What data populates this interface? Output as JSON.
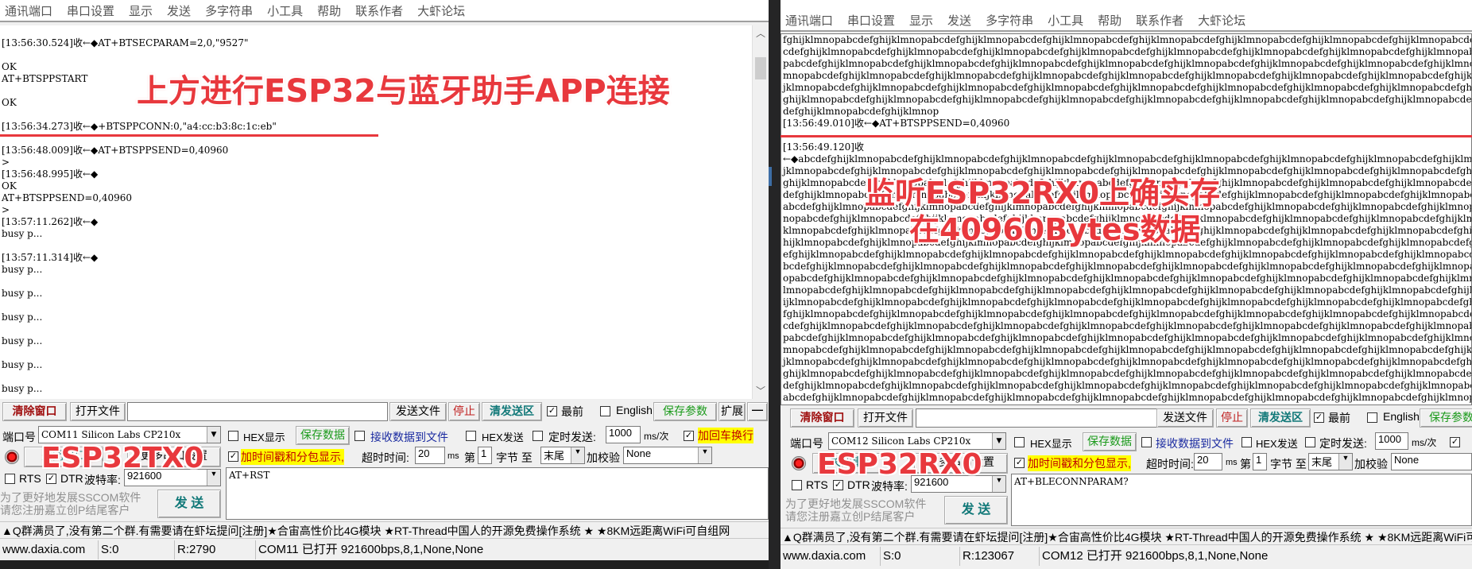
{
  "menu": [
    "通讯端口",
    "串口设置",
    "显示",
    "发送",
    "多字符串",
    "小工具",
    "帮助",
    "联系作者",
    "大虾论坛"
  ],
  "left": {
    "receive_lines": [
      "",
      "[13:56:30.524]收←◆AT+BTSECPARAM=2,0,\"9527\"",
      "",
      "OK",
      "AT+BTSPPSTART",
      "",
      "OK",
      "",
      "[13:56:34.273]收←◆+BTSPPCONN:0,\"a4:cc:b3:8c:1c:eb\"",
      "",
      "[13:56:48.009]收←◆AT+BTSPPSEND=0,40960",
      ">",
      "[13:56:48.995]收←◆",
      "OK",
      "AT+BTSPPSEND=0,40960",
      ">",
      "[13:57:11.262]收←◆",
      "busy p...",
      "",
      "[13:57:11.314]收←◆",
      "busy p...",
      "",
      "busy p...",
      "",
      "busy p...",
      "",
      "busy p...",
      "",
      "busy p...",
      "",
      "busy p..."
    ],
    "annotation_top": "上方进行ESP32与蓝牙助手APP连接",
    "annotation_device": "ESP32TX0",
    "port_value": "COM11 Silicon Labs CP210x",
    "open_button": "关闭串口",
    "more_settings_button": "更多串口设置",
    "send_text": "AT+RST",
    "status": {
      "site": "www.daxia.com",
      "sent": "S:0",
      "received": "R:2790",
      "port_state": "COM11 已打开  921600bps,8,1,None,None"
    }
  },
  "right": {
    "receive_lines": [
      "fghijklmnopabcdefghijklmnopabcdefghijklmnopabcdefghijklmnopabcdefghijklmnopabcdefghijklmnopabcdefghijklmnopabcdefghijklmnopabcdefghi",
      "cdefghijklmnopabcdefghijklmnopabcdefghijklmnopabcdefghijklmnopabcdefghijklmnopabcdefghijklmnopabcdefghijklmnopabcdefghijklmnopabcdef",
      "pabcdefghijklmnopabcdefghijklmnopabcdefghijklmnopabcdefghijklmnopabcdefghijklmnopabcdefghijklmnopabcdefghijklmnopabcdefghijklmnopabc",
      "mnopabcdefghijklmnopabcdefghijklmnopabcdefghijklmnopabcdefghijklmnopabcdefghijklmnopabcdefghijklmnopabcdefghijklmnopabcdefghijklmnop",
      "jklmnopabcdefghijklmnopabcdefghijklmnopabcdefghijklmnopabcdefghijklmnopabcdefghijklmnopabcdefghijklmnopabcdefghijklmnopabcdefghijklm",
      "ghijklmnopabcdefghijklmnopabcdefghijklmnopabcdefghijklmnopabcdefghijklmnopabcdefghijklmnopabcdefghijklmnopabcdefghijklmnopabcdefghij",
      "defghijklmnopabcdefghijklmnop",
      "[13:56:49.010]收←◆AT+BTSPPSEND=0,40960",
      "",
      "[13:56:49.120]收",
      "←◆abcdefghijklmnopabcdefghijklmnopabcdefghijklmnopabcdefghijklmnopabcdefghijklmnopabcdefghijklmnopabcdefghijklmnopabcdefghijklmnop",
      "jklmnopabcdefghijklmnopabcdefghijklmnopabcdefghijklmnopabcdefghijklmnopabcdefghijklmnopabcdefghijklmnopabcdefghijklmnopabcdefghijklm",
      "ghijklmnopabcdefghijklmnopabcdefghijklmnopabcdefghijklmnopabcdefghijklmnopabcdefghijklmnopabcdefghijklmnopabcdefghijklmnopabcdefghij",
      "defghijklmnopabcdefghijklmnopabcdefghijklmnopabcdefghijklmnopabcdefghijklmnopabcdefghijklmnopabcdefghijklmnopabcdefghijklmnopabcdefg",
      "abcdefghijklmnopabcdefghijklmnopabcdefghijklmnopabcdefghijklmnopabcdefghijklmnopabcdefghijklmnopabcdefghijklmnopabcdefghijklmnopabcd",
      "nopabcdefghijklmnopabcdefghijklmnopabcdefghijklmnopabcdefghijklmnopabcdefghijklmnopabcdefghijklmnopabcdefghijklmnopabcdefghijklmnopa",
      "klmnopabcdefghijklmnopabcdefghijklmnopabcdefghijklmnopabcdefghijklmnopabcdefghijklmnopabcdefghijklmnopabcdefghijklmnopabcdefghijklmn",
      "hijklmnopabcdefghijklmnopabcdefghijklmnopabcdefghijklmnopabcdefghijklmnopabcdefghijklmnopabcdefghijklmnopabcdefghijklmnopabcdefghijk",
      "efghijklmnopabcdefghijklmnopabcdefghijklmnopabcdefghijklmnopabcdefghijklmnopabcdefghijklmnopabcdefghijklmnopabcdefghijklmnopabcdefgh",
      "bcdefghijklmnopabcdefghijklmnopabcdefghijklmnopabcdefghijklmnopabcdefghijklmnopabcdefghijklmnopabcdefghijklmnopabcdefghijklmnopabcde",
      "opabcdefghijklmnopabcdefghijklmnopabcdefghijklmnopabcdefghijklmnopabcdefghijklmnopabcdefghijklmnopabcdefghijklmnopabcdefghijklmnopab",
      "lmnopabcdefghijklmnopabcdefghijklmnopabcdefghijklmnopabcdefghijklmnopabcdefghijklmnopabcdefghijklmnopabcdefghijklmnopabcdefghijklmno",
      "ijklmnopabcdefghijklmnopabcdefghijklmnopabcdefghijklmnopabcdefghijklmnopabcdefghijklmnopabcdefghijklmnopabcdefghijklmnopabcdefghijkl",
      "fghijklmnopabcdefghijklmnopabcdefghijklmnopabcdefghijklmnopabcdefghijklmnopabcdefghijklmnopabcdefghijklmnopabcdefghijklmnopabcdefghi",
      "cdefghijklmnopabcdefghijklmnopabcdefghijklmnopabcdefghijklmnopabcdefghijklmnopabcdefghijklmnopabcdefghijklmnopabcdefghijklmnopabcdef",
      "pabcdefghijklmnopabcdefghijklmnopabcdefghijklmnopabcdefghijklmnopabcdefghijklmnopabcdefghijklmnopabcdefghijklmnopabcdefghijklmnopabc",
      "mnopabcdefghijklmnopabcdefghijklmnopabcdefghijklmnopabcdefghijklmnopabcdefghijklmnopabcdefghijklmnopabcdefghijklmnopabcdefghijklmnop",
      "jklmnopabcdefghijklmnopabcdefghijklmnopabcdefghijklmnopabcdefghijklmnopabcdefghijklmnopabcdefghijklmnopabcdefghijklmnopabcdefghijklm",
      "ghijklmnopabcdefghijklmnopabcdefghijklmnopabcdefghijklmnopabcdefghijklmnopabcdefghijklmnopabcdefghijklmnopabcdefghijklmnopabcdefghij",
      "defghijklmnopabcdefghijklmnopabcdefghijklmnopabcdefghijklmnopabcdefghijklmnopabcdefghijklmnopabcdefghijklmnopabcdefghijklmnopabcdefg",
      "abcdefghijklmnopabcdefghijklmnopabcdefghijklmnopabcdefghijklmnopabcdefghijklmnopabcdefghijklmnopabcdefghijklmnopabcdefghijklmnopabcd"
    ],
    "annotation_line1": "监听ESP32RX0上确实存",
    "annotation_line2": "在40960Bytes数据",
    "annotation_device": "ESP32RX0",
    "port_value": "COM12 Silicon Labs CP210x",
    "open_button": "关闭串口",
    "more_settings_button": "更多串口设置",
    "send_text": "AT+BLECONNPARAM?",
    "status": {
      "site": "www.daxia.com",
      "sent": "S:0",
      "received": "R:123067",
      "port_state": "COM12 已打开  921600bps,8,1,None,None"
    }
  },
  "toolbar": {
    "clear_window": "清除窗口",
    "open_file": "打开文件",
    "send_file": "发送文件",
    "stop": "停止",
    "clear_send": "清发送区",
    "topmost": "最前",
    "english": "English",
    "save_params": "保存参数",
    "expand": "扩展",
    "collapse": "—"
  },
  "controls": {
    "port_label": "端口号",
    "hex_display": "HEX显示",
    "save_data": "保存数据",
    "recv_to_file": "接收数据到文件",
    "hex_send": "HEX发送",
    "timed_send": "定时发送:",
    "timed_interval": "1000",
    "interval_unit": "ms/次",
    "add_crlf": "加回车换行",
    "timestamp": "加时间戳和分包显示,",
    "timeout_label": "超时时间:",
    "timeout_value": "20",
    "timeout_unit": "ms",
    "byte_from_label": "第",
    "byte_from_value": "1",
    "byte_label": "字节 至",
    "byte_to_value": "末尾",
    "checksum_label": "加校验",
    "checksum_value": "None",
    "rts": "RTS",
    "dtr": "DTR",
    "baud_label": "波特率:",
    "baud_value": "921600",
    "promo_line1": "为了更好地发展SSCOM软件",
    "promo_line2": "请您注册嘉立创P结尾客户",
    "send_button": "发 送",
    "checkbox_states": {
      "hex_display": false,
      "recv_to_file": false,
      "hex_send": false,
      "timed_send": false,
      "add_crlf": true,
      "timestamp": true,
      "rts": false,
      "dtr": true,
      "topmost": true,
      "english": false
    }
  },
  "marquee": "▲Q群满员了,没有第二个群.有需要请在虾坛提问[注册]★合宙高性价比4G模块 ★RT-Thread中国人的开源免费操作系统 ★ ★8KM远距离WiFi可自组网"
}
